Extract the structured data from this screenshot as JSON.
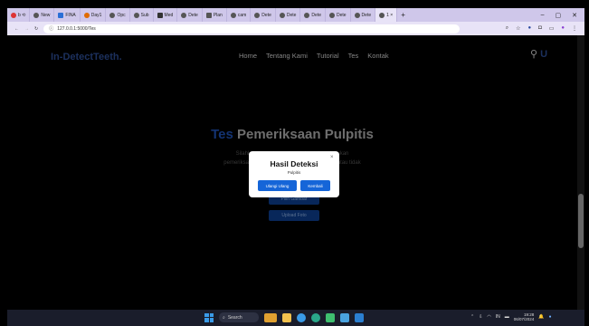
{
  "browser": {
    "tabs": [
      {
        "label": "b ⟲",
        "active": false
      },
      {
        "label": "New",
        "active": false
      },
      {
        "label": "FINA",
        "active": false
      },
      {
        "label": "Day1",
        "active": false
      },
      {
        "label": "Opc",
        "active": false
      },
      {
        "label": "Sub",
        "active": false
      },
      {
        "label": "Med",
        "active": false
      },
      {
        "label": "Dete",
        "active": false
      },
      {
        "label": "Plan",
        "active": false
      },
      {
        "label": "cam",
        "active": false
      },
      {
        "label": "Dete",
        "active": false
      },
      {
        "label": "Dete",
        "active": false
      },
      {
        "label": "Dete",
        "active": false
      },
      {
        "label": "Dete",
        "active": false
      },
      {
        "label": "Dete",
        "active": false
      },
      {
        "label": "1 ×",
        "active": true
      }
    ],
    "new_tab": "+",
    "minimize": "–",
    "maximize": "▢",
    "close": "✕",
    "url": "127.0.0.1:5000/Tes"
  },
  "site": {
    "logo": "In-DetectTeeth.",
    "nav": [
      "Home",
      "Tentang Kami",
      "Tutorial",
      "Tes",
      "Kontak"
    ],
    "hero_accent": "Tes",
    "hero_title": " Pemeriksaan Pulpitis",
    "hero_sub_1": "Silahkan unggah gambar gigi untuk melakukan",
    "hero_sub_2": "pemeriksaan apakah gigi anda terkena pulpitis atau tidak",
    "btn_choose": "Pilih Gambar",
    "btn_upload": "Upload Foto"
  },
  "modal": {
    "title": "Hasil Deteksi",
    "result": "Pulpitis",
    "close": "×",
    "retry": "Ulangi Ulang",
    "back": "Kembali"
  },
  "taskbar": {
    "search": "Search",
    "lang": "IN",
    "time": "19:28",
    "date": "06/07/2024"
  }
}
